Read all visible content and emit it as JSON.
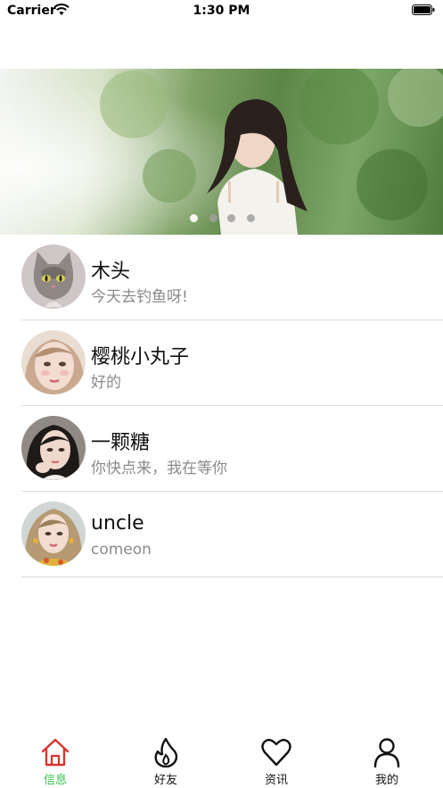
{
  "status_bar": {
    "carrier": "Carrier",
    "time": "1:30 PM"
  },
  "banner": {
    "page_count": 4,
    "active_page": 1
  },
  "messages": [
    {
      "name": "木头",
      "preview": "今天去钓鱼呀!"
    },
    {
      "name": "樱桃小丸子",
      "preview": "好的"
    },
    {
      "name": "一颗糖",
      "preview": "你快点来，我在等你"
    },
    {
      "name": "uncle",
      "preview": "comeon"
    }
  ],
  "tab_bar": {
    "active_color": "#36c24a",
    "tabs": [
      {
        "label": "信息",
        "icon": "home-icon",
        "active": true
      },
      {
        "label": "好友",
        "icon": "flame-icon",
        "active": false
      },
      {
        "label": "资讯",
        "icon": "heart-icon",
        "active": false
      },
      {
        "label": "我的",
        "icon": "person-icon",
        "active": false
      }
    ]
  }
}
